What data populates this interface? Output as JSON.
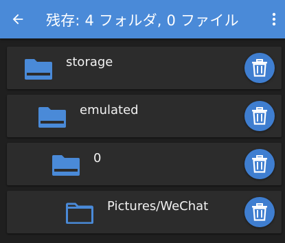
{
  "appbar": {
    "title": "残存: 4 フォルダ, 0 ファイル",
    "back_icon": "arrow-left-icon",
    "menu_icon": "more-vertical-icon",
    "background": "#4a8ad8"
  },
  "folders": [
    {
      "label": "storage",
      "icon": "folder-icon",
      "action_icon": "trash-icon"
    },
    {
      "label": "emulated",
      "icon": "folder-icon",
      "action_icon": "trash-icon"
    },
    {
      "label": "0",
      "icon": "folder-icon",
      "action_icon": "trash-icon"
    },
    {
      "label": "Pictures/WeChat",
      "icon": "folder-open-icon",
      "action_icon": "trash-icon"
    }
  ],
  "colors": {
    "folder": "#4a8ad8",
    "trash_button": "#3f7ed0",
    "row_background": "#2c2c2c",
    "page_background": "#1f1f1f"
  }
}
